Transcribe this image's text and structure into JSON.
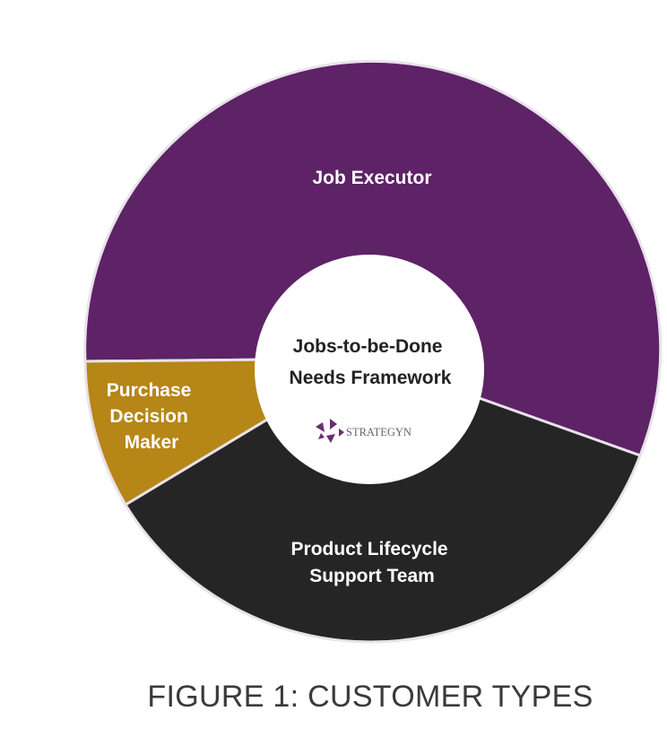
{
  "diagram": {
    "colors": {
      "job_executor": "#5e2266",
      "purchase_decision_maker": "#b68616",
      "product_lifecycle": "#252525",
      "segment_text": "#ffffff",
      "center_fill": "#ffffff",
      "center_text": "#222222",
      "caption": "#3a3a3a",
      "logo_purple": "#6a2c73",
      "logo_text": "#6b5f70"
    },
    "segments": [
      {
        "id": "job-executor",
        "lines": [
          "Job Executor"
        ]
      },
      {
        "id": "purchase-decision-maker",
        "lines": [
          "Purchase",
          "Decision",
          "Maker"
        ]
      },
      {
        "id": "product-lifecycle-support-team",
        "lines": [
          "Product Lifecycle",
          "Support Team"
        ]
      }
    ],
    "center": {
      "lines": [
        "Jobs-to-be-Done",
        "Needs Framework"
      ],
      "logo_text": "STRATEGYN",
      "logo_icon": "strategyn-logo-icon"
    }
  },
  "caption": "FIGURE 1: CUSTOMER TYPES"
}
